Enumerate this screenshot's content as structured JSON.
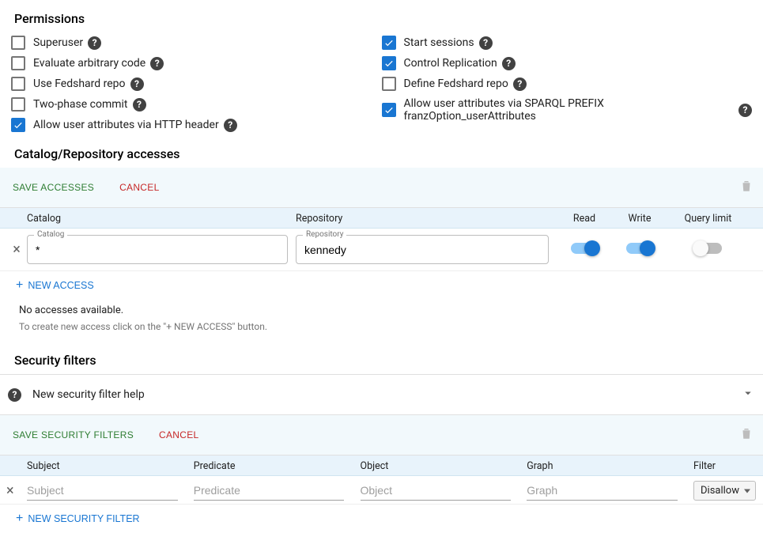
{
  "permissions": {
    "title": "Permissions",
    "left": [
      {
        "label": "Superuser",
        "checked": false
      },
      {
        "label": "Evaluate arbitrary code",
        "checked": false
      },
      {
        "label": "Use Fedshard repo",
        "checked": false
      },
      {
        "label": "Two-phase commit",
        "checked": false
      },
      {
        "label": "Allow user attributes via HTTP header",
        "checked": true
      }
    ],
    "right": [
      {
        "label": "Start sessions",
        "checked": true
      },
      {
        "label": "Control Replication",
        "checked": true
      },
      {
        "label": "Define Fedshard repo",
        "checked": false
      },
      {
        "label": "Allow user attributes via SPARQL PREFIX franzOption_userAttributes",
        "checked": true
      }
    ]
  },
  "accesses": {
    "title": "Catalog/Repository accesses",
    "save_btn": "Save accesses",
    "cancel_btn": "Cancel",
    "headers": {
      "catalog": "Catalog",
      "repository": "Repository",
      "read": "Read",
      "write": "Write",
      "qlimit": "Query limit"
    },
    "row": {
      "catalog_label": "Catalog",
      "catalog_value": "*",
      "repo_label": "Repository",
      "repo_value": "kennedy",
      "read": true,
      "write": true,
      "qlimit": false
    },
    "new_btn": "New access",
    "empty_main": "No accesses available.",
    "empty_sub": "To create new access click on the \"+ NEW ACCESS\" button."
  },
  "filters": {
    "title": "Security filters",
    "banner": "New security filter help",
    "save_btn": "Save security filters",
    "cancel_btn": "Cancel",
    "headers": {
      "subject": "Subject",
      "predicate": "Predicate",
      "object": "Object",
      "graph": "Graph",
      "filter": "Filter"
    },
    "placeholders": {
      "subject": "Subject",
      "predicate": "Predicate",
      "object": "Object",
      "graph": "Graph"
    },
    "filter_value": "Disallow",
    "new_btn": "New security filter"
  }
}
